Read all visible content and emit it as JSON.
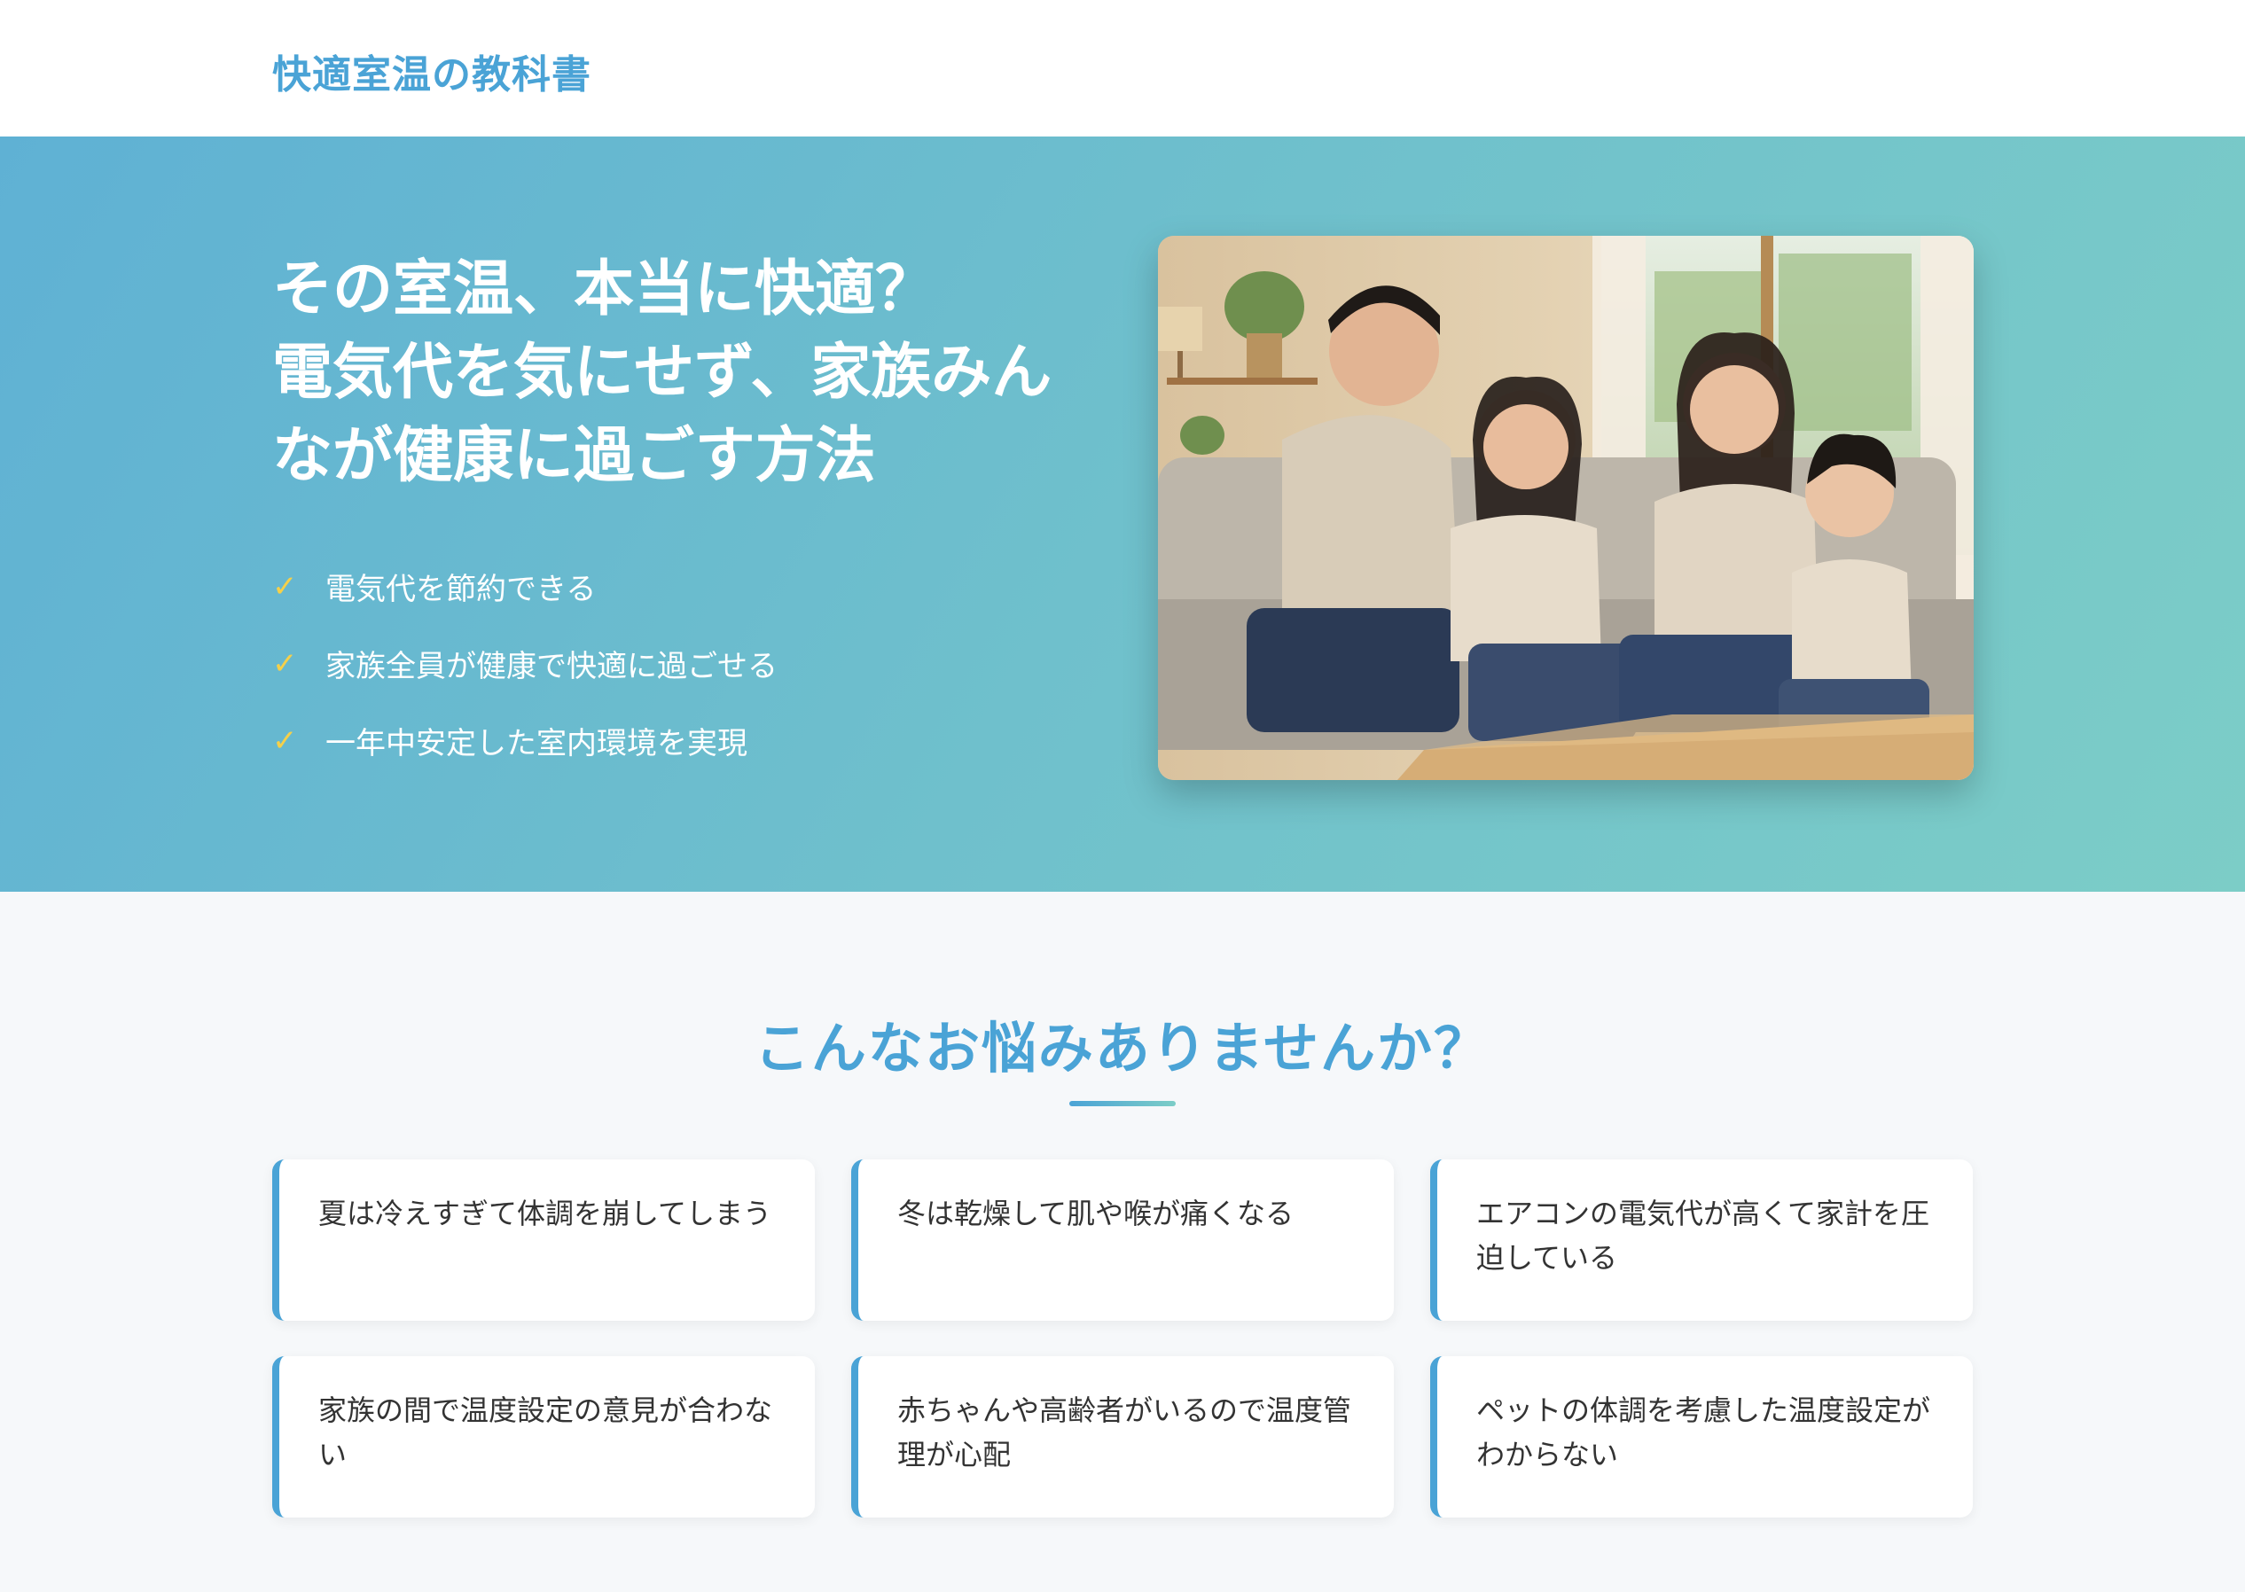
{
  "header": {
    "logo": "快適室温の教科書"
  },
  "hero": {
    "title": "その室温、本当に快適？\n電気代を気にせず、家族みん\nなが健康に過ごす方法",
    "check_mark": "✓",
    "benefits": [
      "電気代を節約できる",
      "家族全員が健康で快適に過ごせる",
      "一年中安定した室内環境を実現"
    ]
  },
  "problems": {
    "title": "こんなお悩みありませんか？",
    "cards": [
      "夏は冷えすぎて体調を崩してしまう",
      "冬は乾燥して肌や喉が痛くなる",
      "エアコンの電気代が高くて家計を圧迫している",
      "家族の間で温度設定の意見が合わない",
      "赤ちゃんや高齢者がいるので温度管理が心配",
      "ペットの体調を考慮した温度設定がわからない"
    ]
  },
  "colors": {
    "brand": "#4aa3d6",
    "hero_gradient_start": "#5fb1d4",
    "hero_gradient_end": "#7ccdc7",
    "check": "#f5d04a"
  }
}
